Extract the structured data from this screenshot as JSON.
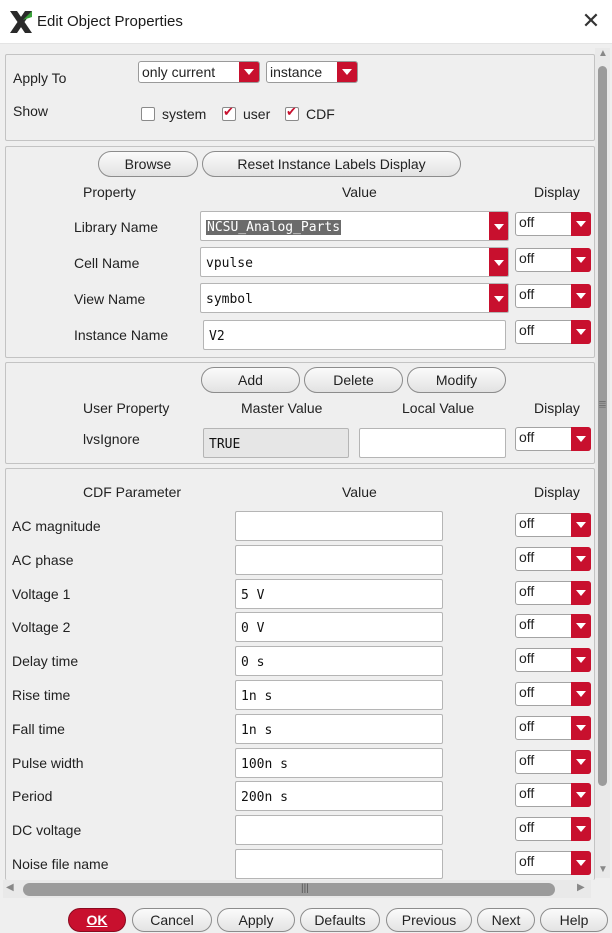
{
  "window": {
    "title": "Edit Object Properties",
    "close_glyph": "✕"
  },
  "apply": {
    "label": "Apply To",
    "scope": "only current",
    "target": "instance"
  },
  "show": {
    "label": "Show",
    "system": {
      "label": "system",
      "checked": false
    },
    "user": {
      "label": "user",
      "checked": true
    },
    "cdf": {
      "label": "CDF",
      "checked": true
    }
  },
  "property_section": {
    "browse": "Browse",
    "reset": "Reset Instance Labels Display",
    "headers": {
      "property": "Property",
      "value": "Value",
      "display": "Display"
    },
    "rows": [
      {
        "label": "Library Name",
        "value": "NCSU_Analog_Parts",
        "display": "off"
      },
      {
        "label": "Cell Name",
        "value": "vpulse",
        "display": "off"
      },
      {
        "label": "View Name",
        "value": "symbol",
        "display": "off"
      },
      {
        "label": "Instance Name",
        "value": "V2",
        "display": "off"
      }
    ]
  },
  "user_section": {
    "add": "Add",
    "delete": "Delete",
    "modify": "Modify",
    "headers": {
      "property": "User Property",
      "master": "Master Value",
      "local": "Local Value",
      "display": "Display"
    },
    "row": {
      "label": "lvsIgnore",
      "master": "TRUE",
      "local": "",
      "display": "off"
    }
  },
  "cdf_section": {
    "headers": {
      "param": "CDF Parameter",
      "value": "Value",
      "display": "Display"
    },
    "rows": [
      {
        "label": "AC magnitude",
        "value": "",
        "display": "off"
      },
      {
        "label": "AC phase",
        "value": "",
        "display": "off"
      },
      {
        "label": "Voltage 1",
        "value": "5 V",
        "display": "off"
      },
      {
        "label": "Voltage 2",
        "value": "0 V",
        "display": "off"
      },
      {
        "label": "Delay time",
        "value": "0 s",
        "display": "off"
      },
      {
        "label": "Rise time",
        "value": "1n s",
        "display": "off"
      },
      {
        "label": "Fall time",
        "value": "1n s",
        "display": "off"
      },
      {
        "label": "Pulse width",
        "value": "100n s",
        "display": "off"
      },
      {
        "label": "Period",
        "value": "200n s",
        "display": "off"
      },
      {
        "label": "DC voltage",
        "value": "",
        "display": "off"
      },
      {
        "label": "Noise file name",
        "value": "",
        "display": "off"
      }
    ]
  },
  "buttons": {
    "ok": "OK",
    "cancel": "Cancel",
    "apply": "Apply",
    "defaults": "Defaults",
    "previous": "Previous",
    "next": "Next",
    "help": "Help"
  },
  "colors": {
    "accent": "#c8102e",
    "panel": "#efefef",
    "selection": "#6b6b6b"
  }
}
